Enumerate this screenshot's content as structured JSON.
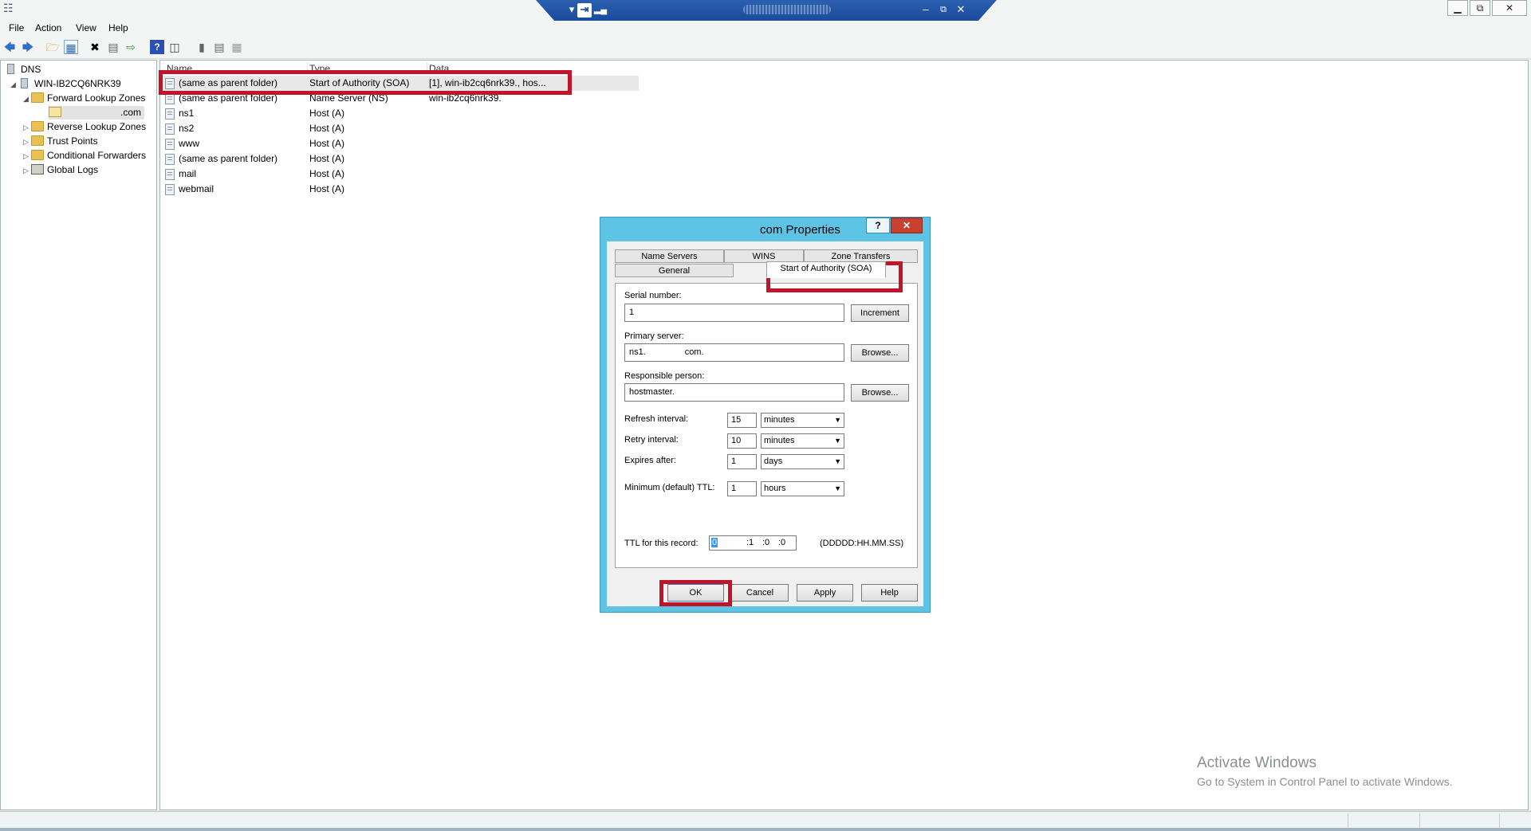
{
  "menu": [
    "File",
    "Action",
    "View",
    "Help"
  ],
  "window_buttons": {
    "minimize": "▁",
    "restore": "⧉",
    "close": "✕"
  },
  "rdp": {
    "minimize": "–",
    "restore": "⧉",
    "close": "✕"
  },
  "tree": {
    "root": "DNS",
    "server": "WIN-IB2CQ6NRK39",
    "forward": "Forward Lookup Zones",
    "zone": ".com",
    "reverse": "Reverse Lookup Zones",
    "trust": "Trust Points",
    "conditional": "Conditional Forwarders",
    "logs": "Global Logs"
  },
  "list": {
    "columns": [
      "Name",
      "Type",
      "Data"
    ],
    "rows": [
      {
        "name": "(same as parent folder)",
        "type": "Start of Authority (SOA)",
        "data": "[1], win-ib2cq6nrk39., hos..."
      },
      {
        "name": "(same as parent folder)",
        "type": "Name Server (NS)",
        "data": "win-ib2cq6nrk39."
      },
      {
        "name": "ns1",
        "type": "Host (A)",
        "data": ""
      },
      {
        "name": "ns2",
        "type": "Host (A)",
        "data": ""
      },
      {
        "name": "www",
        "type": "Host (A)",
        "data": ""
      },
      {
        "name": "(same as parent folder)",
        "type": "Host (A)",
        "data": ""
      },
      {
        "name": "mail",
        "type": "Host (A)",
        "data": ""
      },
      {
        "name": "webmail",
        "type": "Host (A)",
        "data": ""
      }
    ]
  },
  "dialog": {
    "title": "com Properties",
    "help": "?",
    "close": "✕",
    "tabs": {
      "name_servers": "Name Servers",
      "wins": "WINS",
      "zone_transfers": "Zone Transfers",
      "general": "General",
      "soa": "Start of Authority (SOA)"
    },
    "serial_label": "Serial number:",
    "serial_value": "1",
    "increment": "Increment",
    "primary_label": "Primary server:",
    "primary_value": "ns1.                com.",
    "browse": "Browse...",
    "responsible_label": "Responsible person:",
    "responsible_value": "hostmaster.",
    "refresh_label": "Refresh interval:",
    "refresh_value": "15",
    "refresh_unit": "minutes",
    "retry_label": "Retry interval:",
    "retry_value": "10",
    "retry_unit": "minutes",
    "expires_label": "Expires after:",
    "expires_value": "1",
    "expires_unit": "days",
    "minttl_label": "Minimum (default) TTL:",
    "minttl_value": "1",
    "minttl_unit": "hours",
    "ttl_label": "TTL for this record:",
    "ttl_d": "0",
    "ttl_h": ":1",
    "ttl_m": ":0",
    "ttl_s": ":0",
    "ttl_format": "(DDDDD:HH.MM.SS)",
    "ok": "OK",
    "cancel": "Cancel",
    "apply": "Apply",
    "help_btn": "Help"
  },
  "watermark": {
    "line1": "Activate Windows",
    "line2": "Go to System in Control Panel to activate Windows."
  }
}
